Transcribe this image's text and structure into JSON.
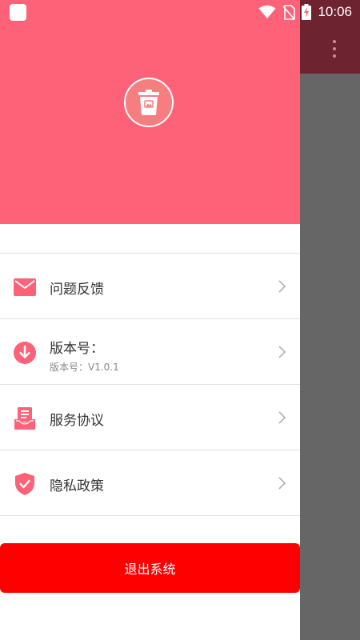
{
  "status_bar": {
    "time": "10:06"
  },
  "colors": {
    "accent": "#fe6278",
    "logout": "#ff0000",
    "scrim": "#666666"
  },
  "menu": {
    "items": [
      {
        "label": "问题反馈",
        "icon": "mail-icon"
      },
      {
        "label": "版本号：",
        "sublabel": "版本号：V1.0.1",
        "icon": "download-icon"
      },
      {
        "label": "服务协议",
        "icon": "document-tray-icon"
      },
      {
        "label": "隐私政策",
        "icon": "shield-check-icon"
      }
    ]
  },
  "logout": {
    "label": "退出系统"
  }
}
